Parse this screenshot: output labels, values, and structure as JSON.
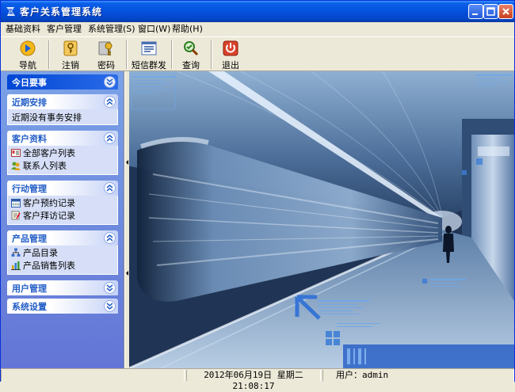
{
  "window": {
    "title": "客户关系管理系统"
  },
  "menu": [
    {
      "label": "基础资料"
    },
    {
      "label": "客户管理"
    },
    {
      "label": "系统管理(S)"
    },
    {
      "label": "窗口(W)"
    },
    {
      "label": "帮助(H)"
    }
  ],
  "toolbar": [
    {
      "label": "导航",
      "icon": "navigate-icon"
    },
    {
      "label": "注销",
      "icon": "key-icon"
    },
    {
      "label": "密码",
      "icon": "password-icon"
    },
    {
      "label": "短信群发",
      "icon": "sms-icon"
    },
    {
      "label": "查询",
      "icon": "query-icon"
    },
    {
      "label": "退出",
      "icon": "power-icon"
    }
  ],
  "sidebar": {
    "today": {
      "title": "今日要事"
    },
    "recent": {
      "title": "近期安排",
      "text": "近期没有事务安排"
    },
    "customer": {
      "title": "客户资料",
      "items": [
        {
          "label": "全部客户列表"
        },
        {
          "label": "联系人列表"
        }
      ]
    },
    "action": {
      "title": "行动管理",
      "items": [
        {
          "label": "客户预约记录"
        },
        {
          "label": "客户拜访记录"
        }
      ]
    },
    "product": {
      "title": "产品管理",
      "items": [
        {
          "label": "产品目录"
        },
        {
          "label": "产品销售列表"
        }
      ]
    },
    "user": {
      "title": "用户管理"
    },
    "settings": {
      "title": "系统设置"
    }
  },
  "status": {
    "datetime": "2012年06月19日 星期二 21:08:17",
    "user": "用户：admin"
  },
  "colors": {
    "titlebar": "#0551dd",
    "sidebar": "#7ba2e7",
    "header_text": "#215dc6"
  }
}
